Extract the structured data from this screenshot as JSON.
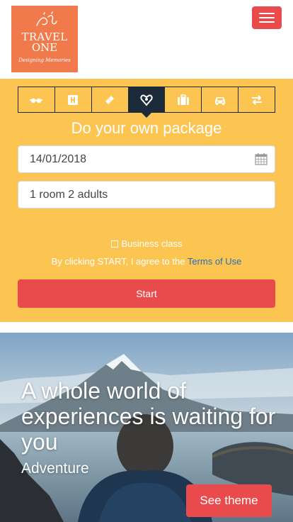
{
  "header": {
    "logo": {
      "line1": "TRAVEL",
      "line2": "ONE",
      "tagline": "Designing Memories",
      "color": "#f07a4c"
    },
    "menu_icon": "hamburger-icon"
  },
  "search": {
    "tabs": [
      {
        "name": "tab-flights",
        "icon": "glasses-icon"
      },
      {
        "name": "tab-hotels",
        "icon": "hotel-icon"
      },
      {
        "name": "tab-tickets",
        "icon": "ticket-icon"
      },
      {
        "name": "tab-packages",
        "icon": "heart-pin-icon",
        "active": true
      },
      {
        "name": "tab-luggage",
        "icon": "suitcase-icon"
      },
      {
        "name": "tab-cars",
        "icon": "car-icon"
      },
      {
        "name": "tab-transfers",
        "icon": "transfer-icon"
      }
    ],
    "title": "Do your own package",
    "date_value": "14/01/2018",
    "rooms_value": "1 room 2 adults",
    "business_label": "Business class",
    "terms_prefix": "By clicking START, I agree to the ",
    "terms_link": "Terms of Use",
    "start_label": "Start",
    "panel_color": "#fcc451",
    "accent_color": "#e94b4d"
  },
  "hero": {
    "title": "A whole world of experiences is waiting for you",
    "subtitle": "Adventure",
    "button_label": "See theme"
  }
}
